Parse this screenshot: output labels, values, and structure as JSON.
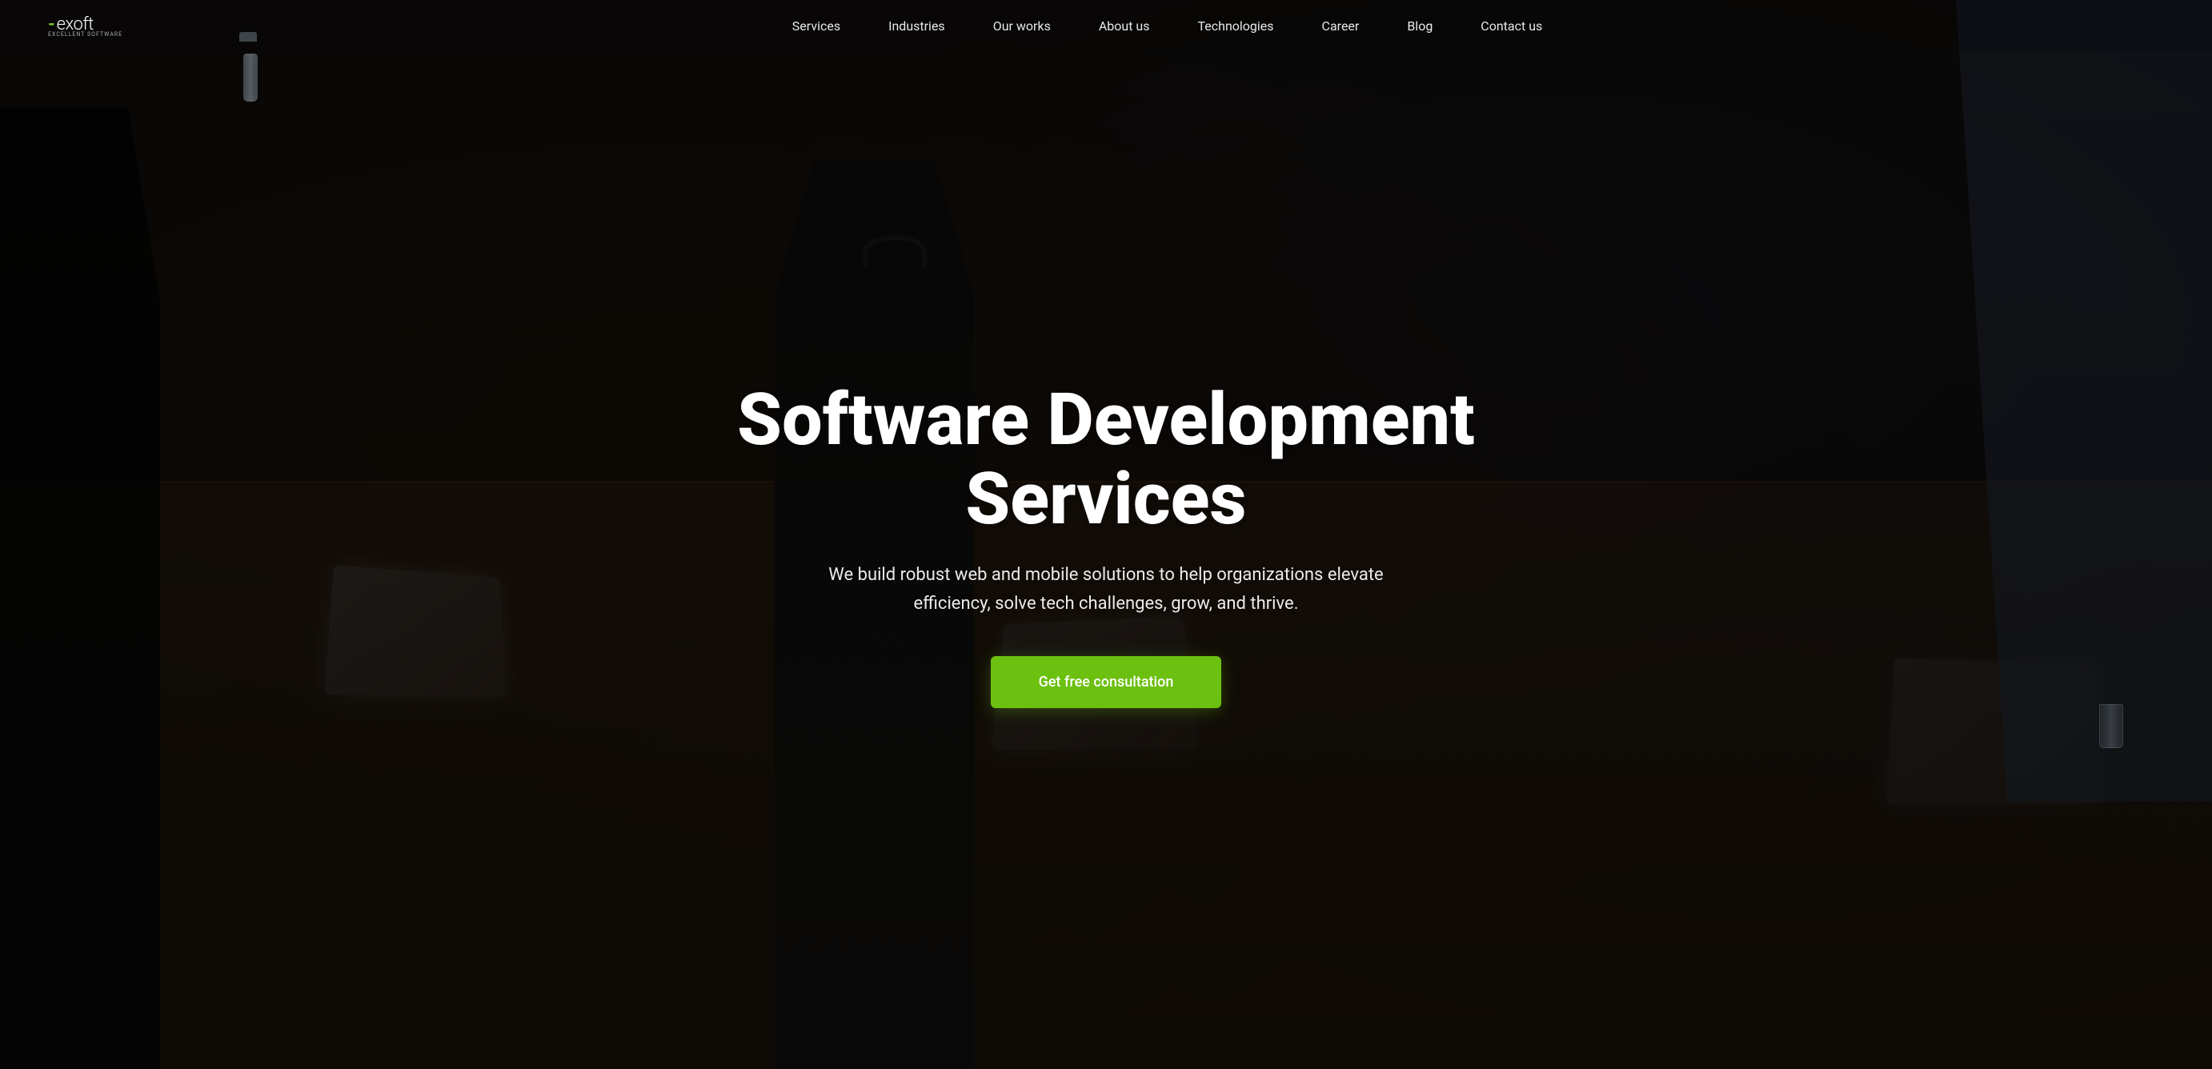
{
  "brand": {
    "name": "exoft",
    "dash": "-",
    "subtitle": "excellent software",
    "logo_label": "Exoft logo"
  },
  "nav": {
    "links": [
      {
        "id": "services",
        "label": "Services",
        "href": "#"
      },
      {
        "id": "industries",
        "label": "Industries",
        "href": "#"
      },
      {
        "id": "our-works",
        "label": "Our works",
        "href": "#"
      },
      {
        "id": "about-us",
        "label": "About us",
        "href": "#"
      },
      {
        "id": "technologies",
        "label": "Technologies",
        "href": "#"
      },
      {
        "id": "career",
        "label": "Career",
        "href": "#"
      },
      {
        "id": "blog",
        "label": "Blog",
        "href": "#"
      },
      {
        "id": "contact-us",
        "label": "Contact us",
        "href": "#"
      }
    ]
  },
  "hero": {
    "title": "Software Development Services",
    "subtitle": "We build robust web and mobile solutions to help organizations elevate efficiency, solve tech challenges, grow, and thrive.",
    "cta_label": "Get free consultation",
    "colors": {
      "cta_bg": "#6cc010",
      "cta_text": "#ffffff",
      "title_color": "#ffffff",
      "subtitle_color": "#ffffff"
    }
  }
}
